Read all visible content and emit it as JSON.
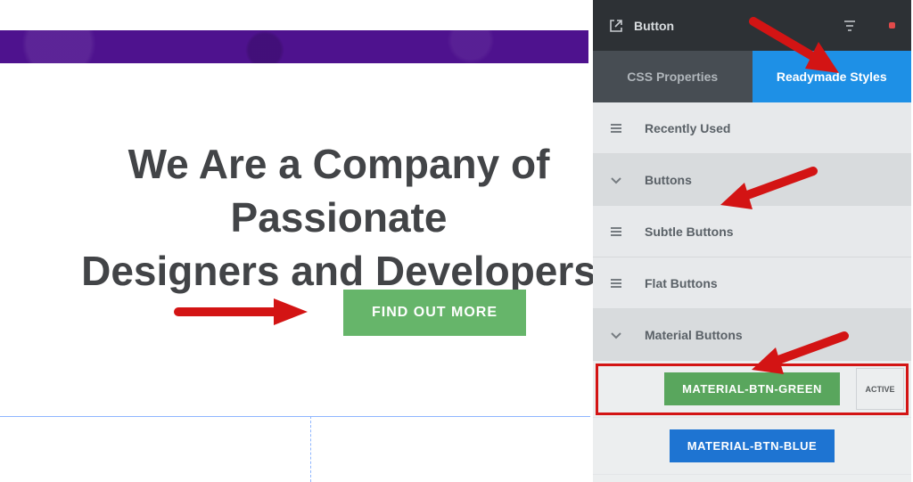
{
  "page": {
    "headline": "We Are a Company of Passionate\nDesigners and Developers",
    "cta_label": "FIND OUT MORE"
  },
  "panel": {
    "header_title": "Button",
    "tabs": {
      "css": "CSS Properties",
      "styles": "Readymade Styles"
    },
    "categories": {
      "recent": "Recently Used",
      "buttons": "Buttons",
      "subtle": "Subtle Buttons",
      "flat": "Flat Buttons",
      "material": "Material Buttons"
    },
    "styles": {
      "green": "MATERIAL-BTN-GREEN",
      "blue": "MATERIAL-BTN-BLUE",
      "active_badge": "ACTIVE"
    }
  }
}
